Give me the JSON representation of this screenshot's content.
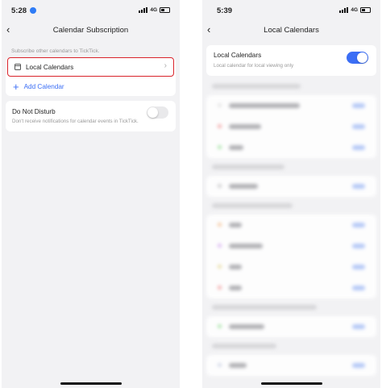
{
  "left_screen": {
    "status": {
      "time": "5:28",
      "network": "4G"
    },
    "nav": {
      "title": "Calendar Subscription"
    },
    "section_hint": "Subscribe other calendars to TickTick.",
    "subscription_item": {
      "label": "Local Calendars"
    },
    "add_item": {
      "label": "Add Calendar"
    },
    "dnd": {
      "title": "Do Not Disturb",
      "description": "Don't receive notifications for calendar events in TickTick.",
      "enabled": false
    }
  },
  "right_screen": {
    "status": {
      "time": "5:39",
      "network": "4G"
    },
    "nav": {
      "title": "Local Calendars"
    },
    "toggle_card": {
      "title": "Local Calendars",
      "description": "Local calendar for local viewing only",
      "enabled": true
    }
  },
  "colors": {
    "accent": "#3b6ef5",
    "highlight_border": "#d9232b",
    "background": "#f2f2f4",
    "blur_dot_colors": [
      "#e2e2e2",
      "#f2a4a4",
      "#a6e3a6",
      "#c9c9c9",
      "#f6c59a",
      "#d9b3f2",
      "#e8dca0",
      "#f2a4a4",
      "#a6e3a6",
      "#cfd5e6"
    ]
  },
  "icons": {
    "back": "chevron-left-icon",
    "calendar": "calendar-icon",
    "chevron": "chevron-right-icon",
    "add": "plus-icon"
  }
}
